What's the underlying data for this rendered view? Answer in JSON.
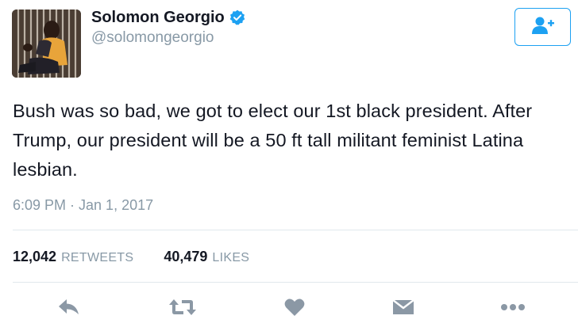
{
  "author": {
    "display_name": "Solomon Georgio",
    "handle": "@solomongeorgio",
    "verified": true
  },
  "tweet": {
    "text": "Bush was so bad, we got to elect our 1st black president. After Trump, our president will be a 50 ft tall militant feminist Latina lesbian.",
    "timestamp": "6:09 PM · Jan 1, 2017"
  },
  "stats": {
    "retweets_count": "12,042",
    "retweets_label": "RETWEETS",
    "likes_count": "40,479",
    "likes_label": "LIKES"
  },
  "actions": [
    "reply-icon",
    "retweet-icon",
    "like-icon",
    "direct-message-icon",
    "more-icon"
  ],
  "colors": {
    "accent": "#1da1f2",
    "muted_text": "#8899a6",
    "icon_gray": "#8b98a5",
    "divider": "#e1e8ed"
  }
}
